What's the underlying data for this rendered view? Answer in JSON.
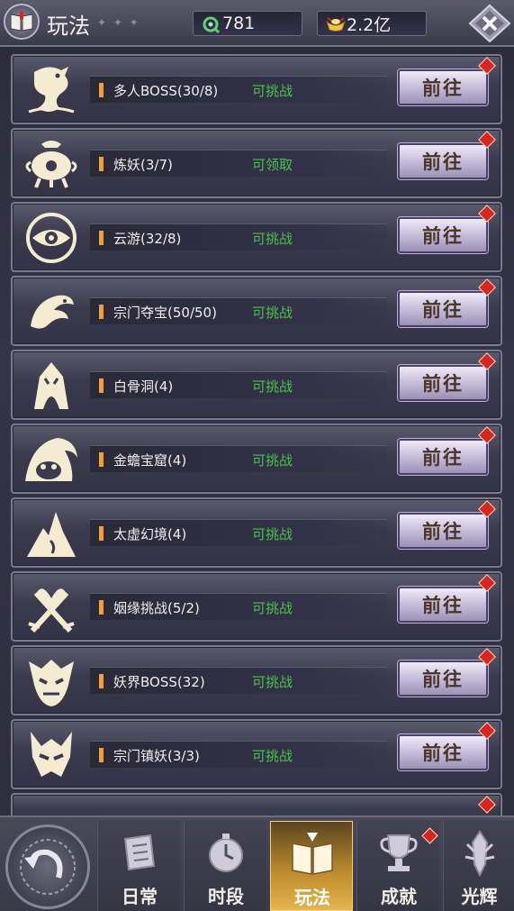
{
  "header": {
    "title": "玩法",
    "jade_amount": "781",
    "gold_amount": "2.2亿"
  },
  "colors": {
    "status_green": "#49c24a",
    "marker_orange": "#f2a13a",
    "badge_red": "#d8261f",
    "active_tab_gold": "#e6b44a"
  },
  "activities": [
    {
      "name": "多人BOSS(30/8)",
      "status": "可挑战",
      "button": "前往",
      "icon": "dragon-icon"
    },
    {
      "name": "炼妖(3/7)",
      "status": "可领取",
      "button": "前往",
      "icon": "cauldron-icon"
    },
    {
      "name": "云游(32/8)",
      "status": "可挑战",
      "button": "前往",
      "icon": "swirl-eye-icon"
    },
    {
      "name": "宗门夺宝(50/50)",
      "status": "可挑战",
      "button": "前往",
      "icon": "phoenix-icon"
    },
    {
      "name": "白骨洞(4)",
      "status": "可挑战",
      "button": "前往",
      "icon": "bone-cave-icon"
    },
    {
      "name": "金蟾宝窟(4)",
      "status": "可挑战",
      "button": "前往",
      "icon": "toad-cave-icon"
    },
    {
      "name": "太虚幻境(4)",
      "status": "可挑战",
      "button": "前往",
      "icon": "mountain-icon"
    },
    {
      "name": "姻缘挑战(5/2)",
      "status": "可挑战",
      "button": "前往",
      "icon": "crossed-swords-heart-icon"
    },
    {
      "name": "妖界BOSS(32)",
      "status": "可挑战",
      "button": "前往",
      "icon": "demon-mask-icon"
    },
    {
      "name": "宗门镇妖(3/3)",
      "status": "可挑战",
      "button": "前往",
      "icon": "horned-demon-icon"
    }
  ],
  "nav": [
    {
      "label": "日常",
      "icon": "scroll-icon",
      "active": false
    },
    {
      "label": "时段",
      "icon": "clock-icon",
      "active": false
    },
    {
      "label": "玩法",
      "icon": "book-icon",
      "active": true
    },
    {
      "label": "成就",
      "icon": "trophy-icon",
      "active": false
    },
    {
      "label": "光辉",
      "icon": "glory-icon",
      "active": false
    }
  ]
}
